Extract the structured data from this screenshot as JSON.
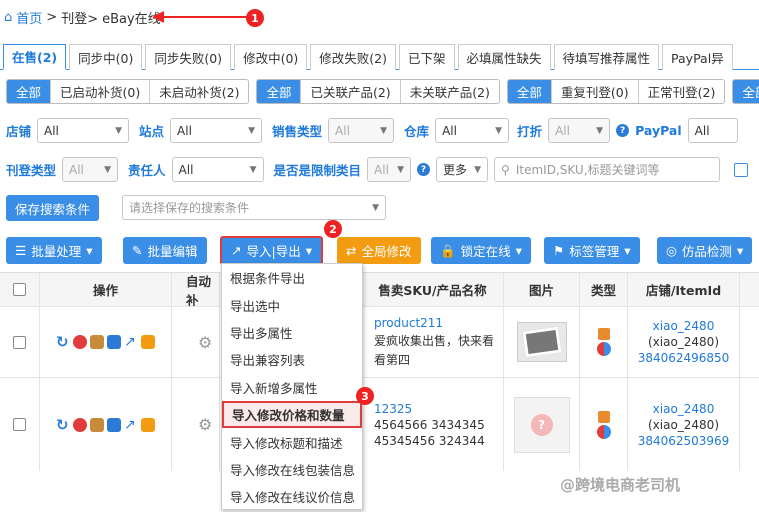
{
  "breadcrumb": {
    "home": "首页",
    "sep": ">",
    "mid": "刊登>",
    "current": "eBay在线"
  },
  "callouts": [
    "1",
    "2",
    "3"
  ],
  "tabs": [
    "在售(2)",
    "同步中(0)",
    "同步失败(0)",
    "修改中(0)",
    "修改失败(2)",
    "已下架",
    "必填属性缺失",
    "待填写推荐属性",
    "PayPal异"
  ],
  "segments": [
    [
      "全部",
      "已启动补货(0)",
      "未启动补货(2)"
    ],
    [
      "全部",
      "已关联产品(2)",
      "未关联产品(2)"
    ],
    [
      "全部",
      "重复刊登(0)",
      "正常刊登(2)"
    ],
    [
      "全部"
    ]
  ],
  "filters1": {
    "shop": "店铺",
    "shop_val": "All",
    "site": "站点",
    "site_val": "All",
    "saletype": "销售类型",
    "saletype_val": "All",
    "warehouse": "仓库",
    "warehouse_val": "All",
    "discount": "打折",
    "discount_val": "All",
    "paypal": "PayPal",
    "paypal_val": "All"
  },
  "filters2": {
    "listtype": "刊登类型",
    "listtype_val": "All",
    "owner": "责任人",
    "owner_val": "All",
    "restricted": "是否是限制类目",
    "restricted_val": "All",
    "more": "更多",
    "search_placeholder": "ItemID,SKU,标题关键词等"
  },
  "save": {
    "button": "保存搜索条件",
    "placeholder": "请选择保存的搜索条件"
  },
  "actions": {
    "batch": "批量处理",
    "edit": "批量编辑",
    "import": "导入|导出",
    "global": "全局修改",
    "lock": "锁定在线",
    "tag": "标签管理",
    "imitation": "仿品检测"
  },
  "columns": {
    "op": "操作",
    "auto": "自动补",
    "sku": "售卖SKU/产品名称",
    "img": "图片",
    "type": "类型",
    "store": "店铺/ItemId"
  },
  "rows": [
    {
      "sku": "product211",
      "name1": "爱疯收集出售，快来看",
      "name2": "看第四",
      "store": "xiao_2480",
      "store2": "(xiao_2480)",
      "itemid": "384062496850"
    },
    {
      "sku": "12325",
      "name1": "4564566 3434345",
      "name2": "45345456 324344",
      "store": "xiao_2480",
      "store2": "(xiao_2480)",
      "itemid": "384062503969"
    }
  ],
  "menu": [
    "根据条件导出",
    "导出选中",
    "导出多属性",
    "导出兼容列表",
    "导入新增多属性",
    "导入修改价格和数量",
    "导入修改标题和描述",
    "导入修改在线包装信息",
    "导入修改在线议价信息"
  ],
  "watermark": "@跨境电商老司机",
  "colors": {
    "accent": "#3a8ee6",
    "callout": "#e22",
    "orange": "#f39c12"
  }
}
